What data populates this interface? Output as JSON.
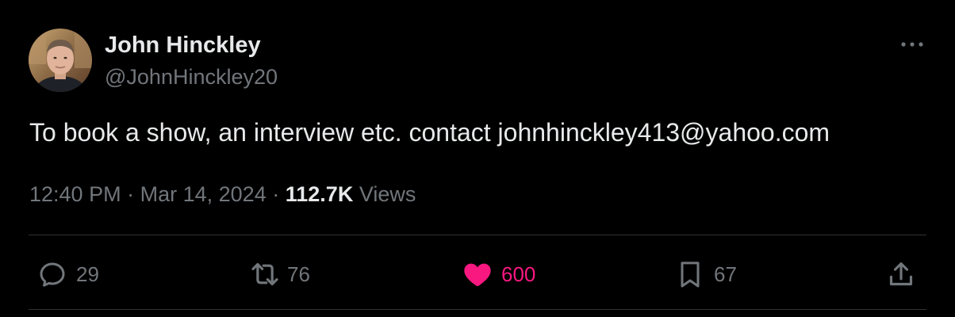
{
  "author": {
    "name": "John Hinckley",
    "handle": "@JohnHinckley20"
  },
  "tweet": {
    "text": "To book a show, an interview etc. contact johnhinckley413@yahoo.com",
    "time": "12:40 PM",
    "separator": "·",
    "date": "Mar 14, 2024",
    "views_count": "112.7K",
    "views_label": "Views"
  },
  "actions": {
    "replies": "29",
    "reposts": "76",
    "likes": "600",
    "bookmarks": "67"
  },
  "icons": {
    "more": "more-horizontal-icon",
    "reply": "reply-icon",
    "repost": "repost-icon",
    "like": "heart-icon",
    "bookmark": "bookmark-icon",
    "share": "share-icon"
  },
  "colors": {
    "background": "#000000",
    "text_primary": "#e7e9ea",
    "text_secondary": "#71767b",
    "like_active": "#f91880",
    "divider": "#2f3336"
  }
}
